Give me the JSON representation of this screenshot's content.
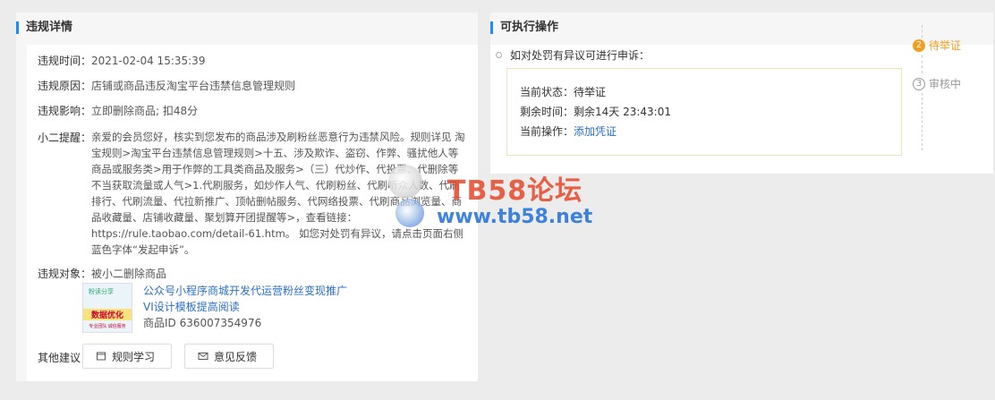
{
  "left": {
    "title": "违规详情",
    "time": {
      "label": "违规时间：",
      "value": "2021-02-04 15:35:39"
    },
    "reason": {
      "label": "违规原因：",
      "value": "店铺或商品违反淘宝平台违禁信息管理规则"
    },
    "impact": {
      "label": "违规影响：",
      "value": "立即删除商品; 扣48分"
    },
    "tip": {
      "label": "小二提醒：",
      "value": "亲爱的会员您好，核实到您发布的商品涉及刷粉丝恶意行为违禁风险。规则详见 淘宝规则>淘宝平台违禁信息管理规则>十五、涉及欺诈、盗窃、作弊、骚扰他人等商品或服务类>用于作弊的工具类商品及服务>（三）代炒作、代投票、代删除等不当获取流量或人气>1.代刷服务，如炒作人气、代刷粉丝、代刷听众人数、代刷排行、代刷流量、代拉新推广、顶帖删帖服务、代网络投票、代刷商品浏览量、商品收藏量、店铺收藏量、聚划算开团提醒等>，查看链接：https://rule.taobao.com/detail-61.htm。 如您对处罚有异议，请点击页面右侧蓝色字体“发起申诉”。"
    },
    "target": {
      "label": "违规对象：",
      "value": "被小二删除商品",
      "product_line1": "公众号小程序商城开发代运营粉丝变现推广",
      "product_line2": "VI设计模板提高阅读",
      "product_id": "商品ID 636007354976",
      "thumb_text1": "粉读分享",
      "thumb_text2": "数据优化",
      "thumb_text3": "专业团队 诚信服务"
    },
    "other": {
      "label": "其他建议：",
      "btn_rules": "规则学习",
      "btn_feedback": "意见反馈"
    }
  },
  "right": {
    "title": "可执行操作",
    "appeal_title": "如对处罚有异议可进行申诉：",
    "status_label": "当前状态：",
    "status_value": "待举证",
    "remain_label": "剩余时间：",
    "remain_value": "剩余14天 23:43:01",
    "op_label": "当前操作：",
    "op_link": "添加凭证",
    "steps": [
      {
        "num": "2",
        "label": "待举证",
        "color": "#f0a020"
      },
      {
        "num": "3",
        "label": "审核中",
        "color": "#999999"
      }
    ]
  },
  "watermark": {
    "line1": "TB58论坛",
    "line2": "www.tb58.net"
  },
  "colors": {
    "accent": "#1e8cf0",
    "link": "#2a6fcd",
    "active_step": "#f0a020"
  }
}
